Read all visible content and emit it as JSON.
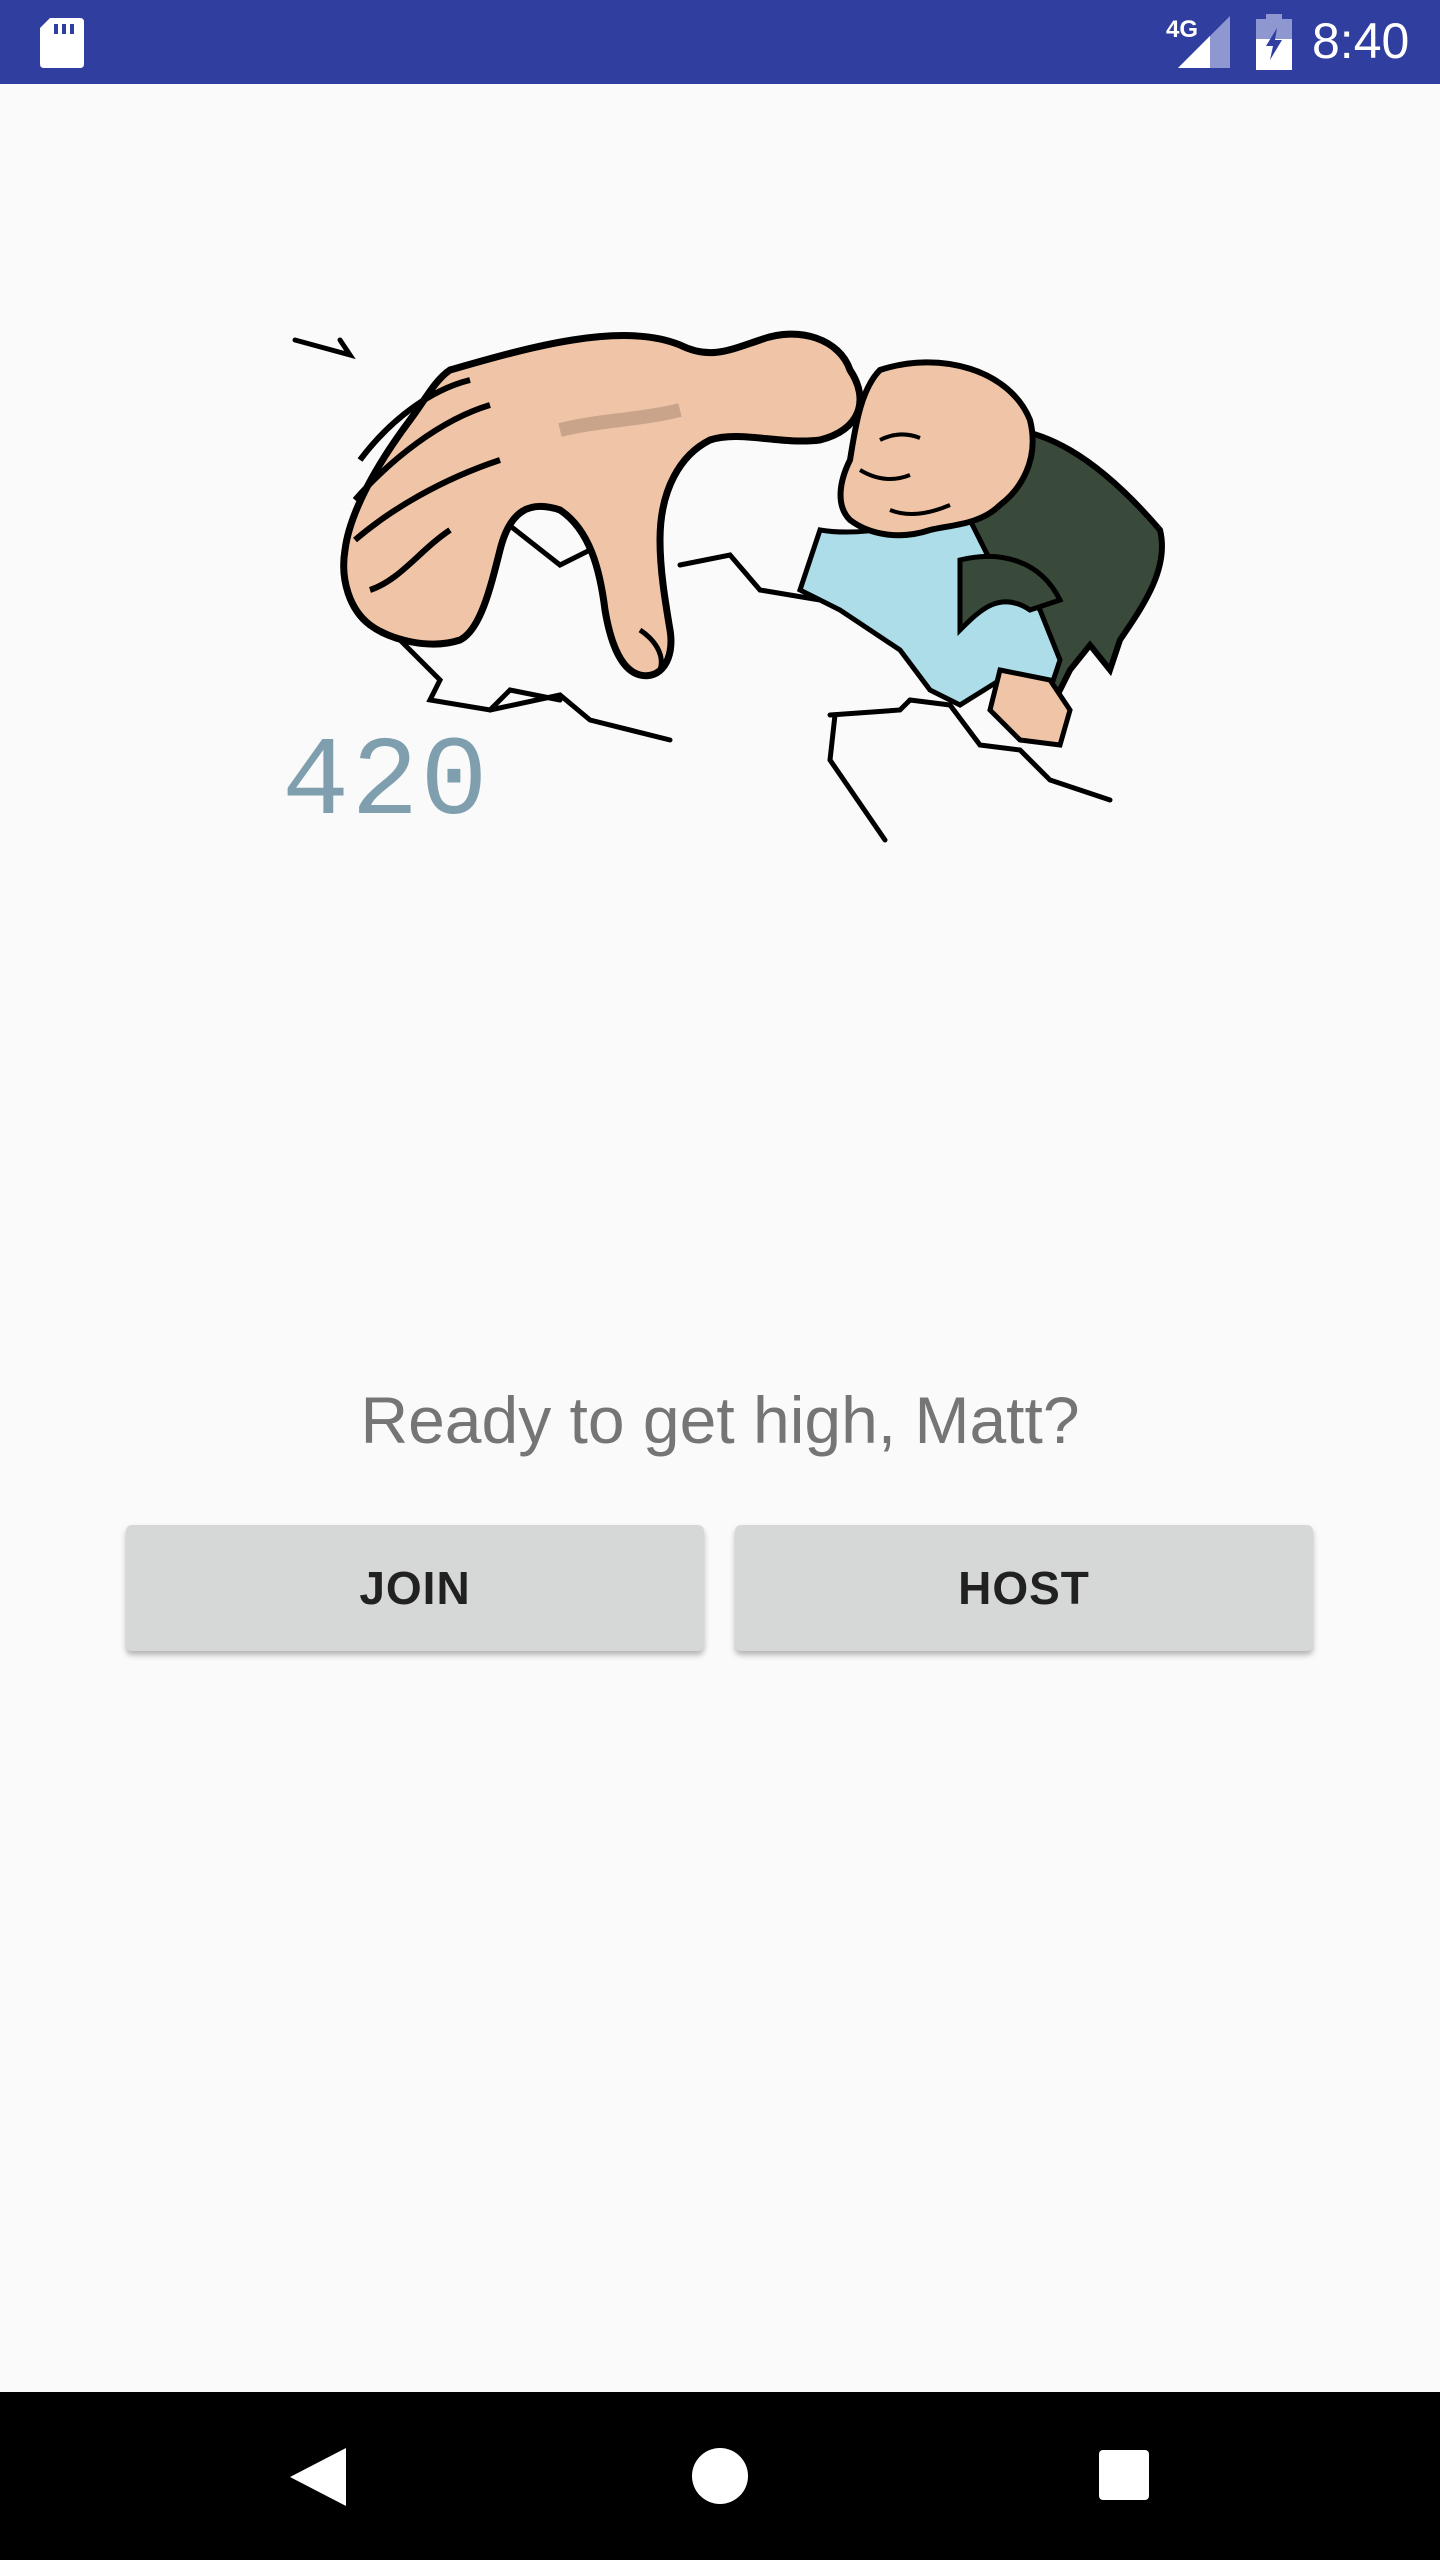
{
  "status_bar": {
    "network_label": "4G",
    "time": "8:40",
    "background_color": "#303f9f",
    "icons": [
      "sd-card-icon",
      "signal-icon",
      "battery-charging-icon"
    ]
  },
  "main": {
    "score": "420",
    "score_color": "#7f9faf",
    "prompt": "Ready to get high, Matt?",
    "buttons": {
      "join_label": "JOIN",
      "host_label": "HOST"
    }
  },
  "nav_bar": {
    "icons": [
      "back-icon",
      "home-icon",
      "recents-icon"
    ]
  }
}
